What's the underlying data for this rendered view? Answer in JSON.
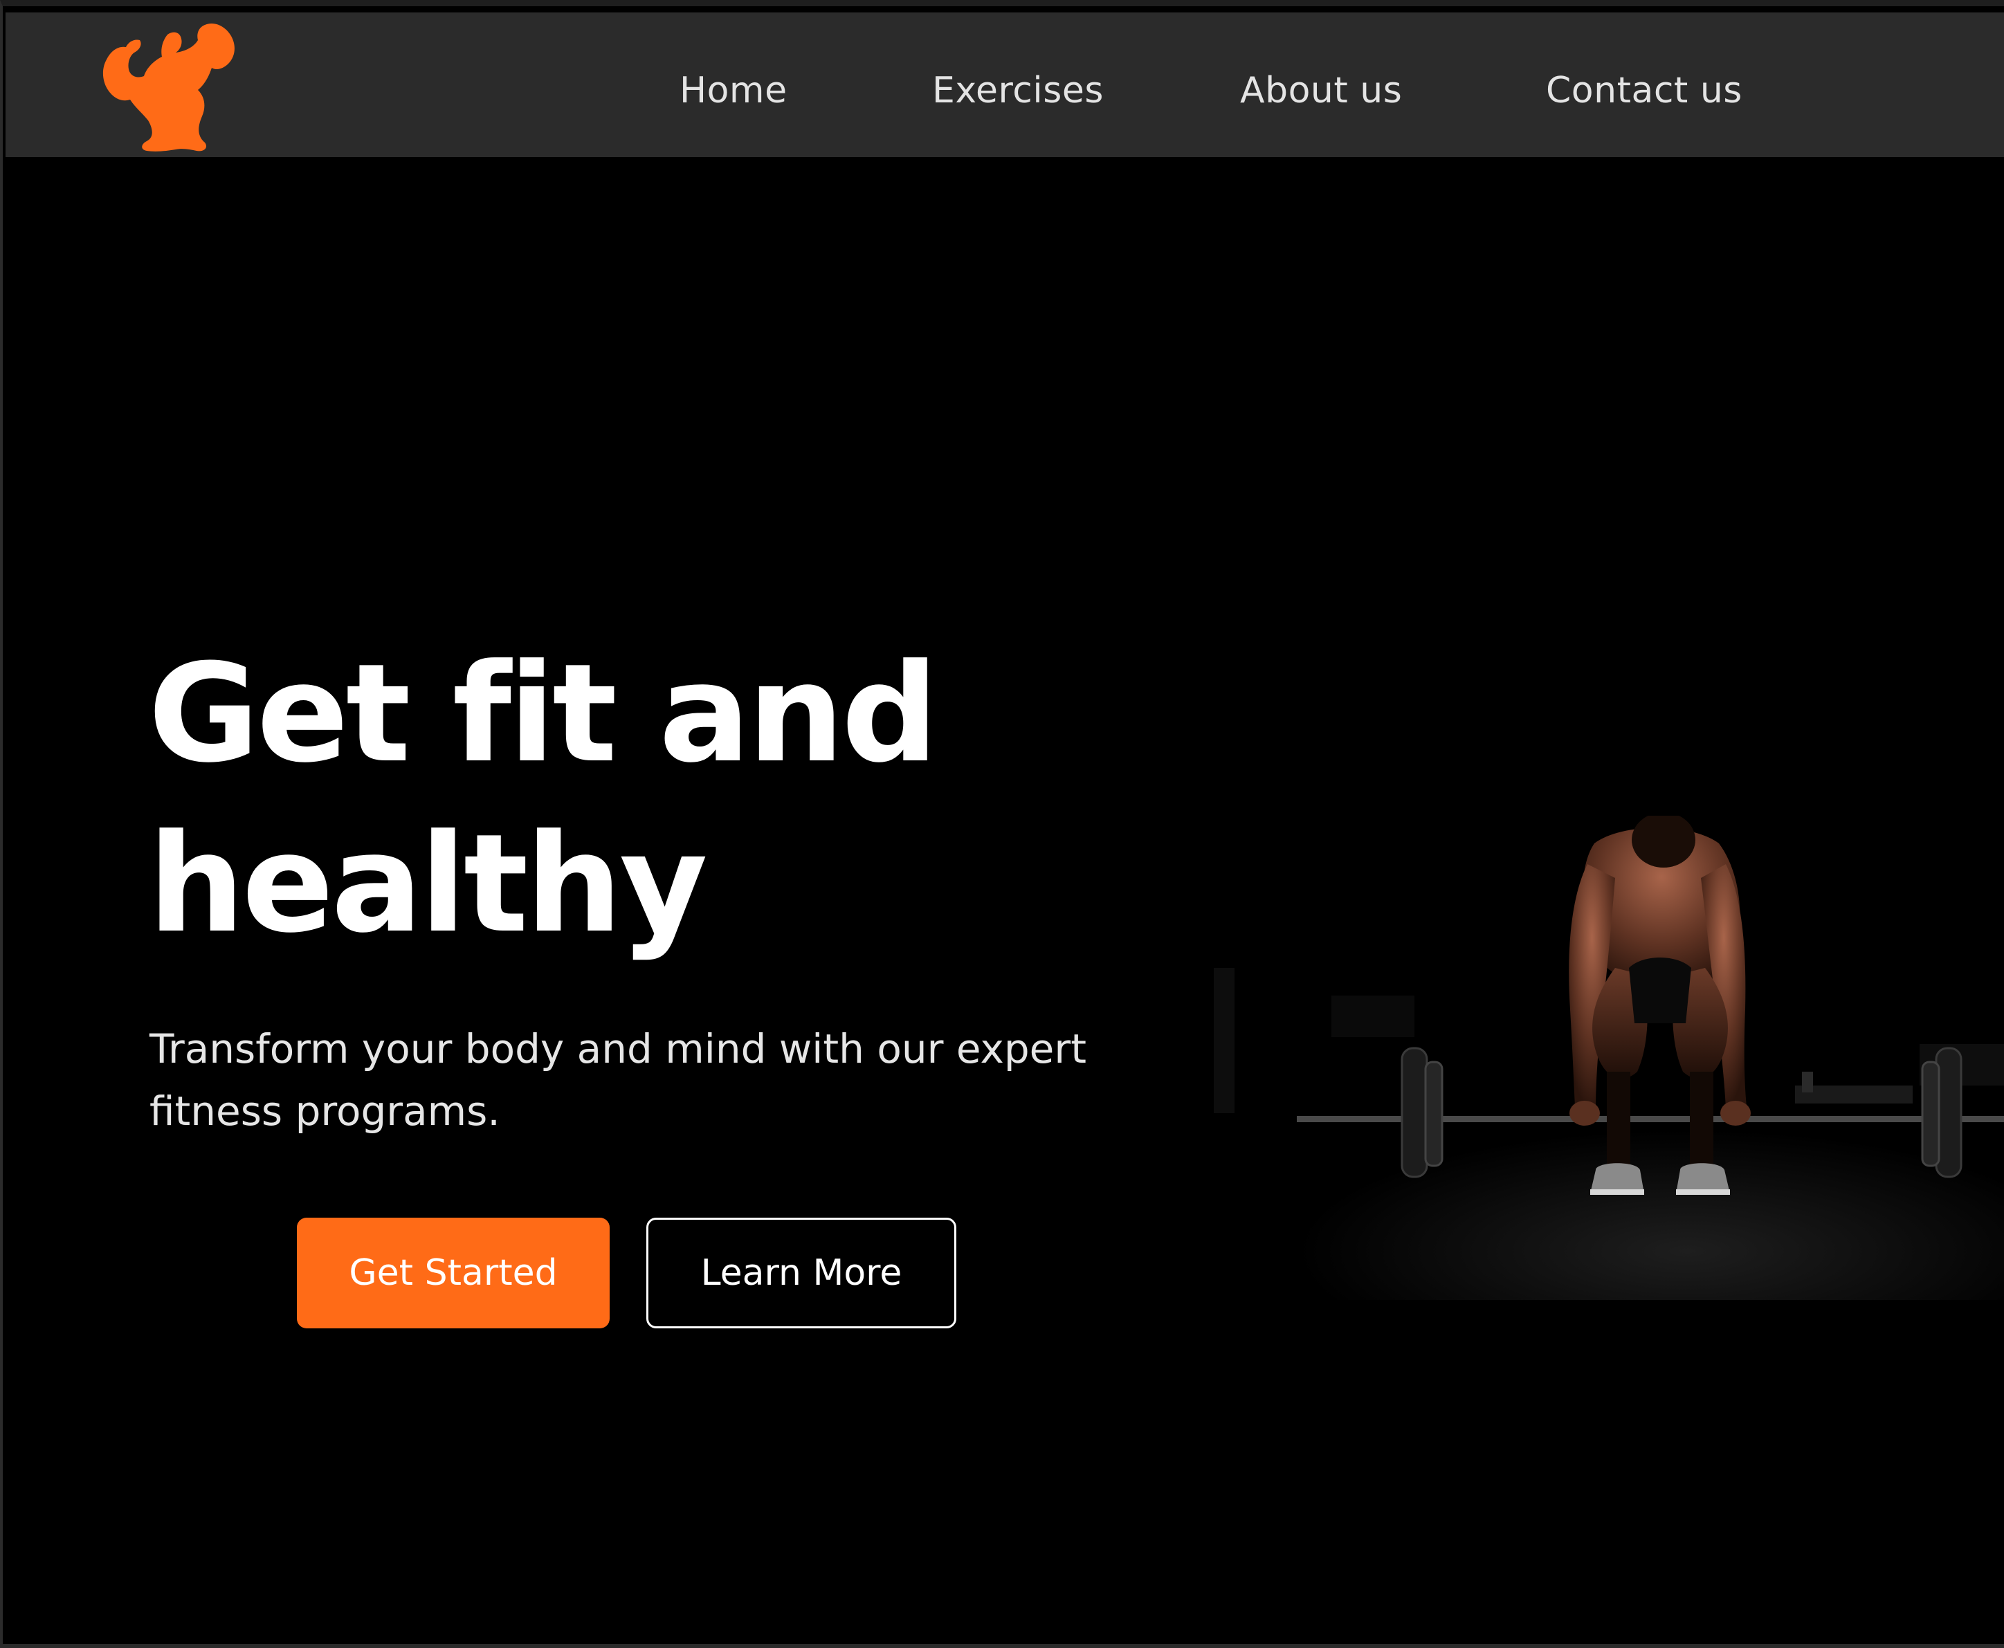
{
  "navbar": {
    "logo_icon": "bodybuilder-flex-icon",
    "links": [
      {
        "label": "Home"
      },
      {
        "label": "Exercises"
      },
      {
        "label": "About us"
      },
      {
        "label": "Contact us"
      }
    ]
  },
  "hero": {
    "title_line1": "Get fit and",
    "title_line2": "healthy",
    "subtitle": "Transform your body and mind with our expert fitness programs.",
    "primary_button": "Get Started",
    "secondary_button": "Learn More",
    "image": "man-lifting-barbell-photo"
  },
  "colors": {
    "accent": "#ff6b17",
    "navbar_bg": "#2b2b2b",
    "page_bg": "#000000",
    "text": "#ffffff"
  }
}
